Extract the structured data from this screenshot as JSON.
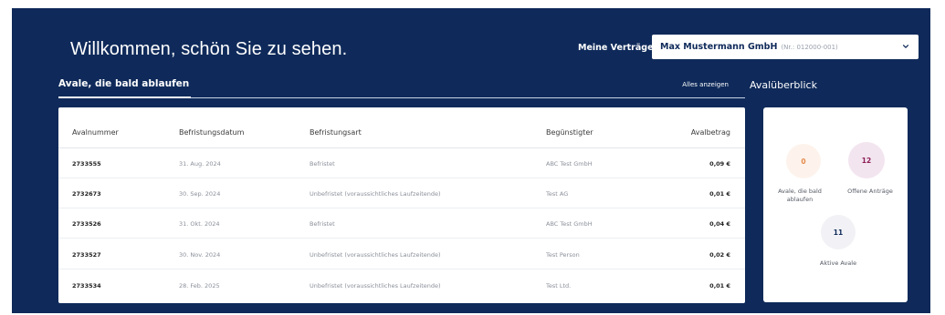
{
  "header": {
    "welcome": "Willkommen, schön Sie zu sehen.",
    "contracts_label": "Meine Verträge",
    "contract_name": "Max Mustermann GmbH",
    "contract_nr": "(Nr.: 012000-001)"
  },
  "tabs": {
    "active_label": "Avale, die bald ablaufen",
    "show_all": "Alles anzeigen"
  },
  "table": {
    "headers": [
      "Avalnummer",
      "Befristungsdatum",
      "Befristungsart",
      "Begünstigter",
      "Avalbetrag"
    ],
    "rows": [
      [
        "2733555",
        "31. Aug. 2024",
        "Befristet",
        "ABC Test GmbH",
        "0,09 €"
      ],
      [
        "2732673",
        "30. Sep. 2024",
        "Unbefristet (voraussichtliches Laufzeitende)",
        "Test AG",
        "0,01 €"
      ],
      [
        "2733526",
        "31. Okt. 2024",
        "Befristet",
        "ABC Test GmbH",
        "0,04 €"
      ],
      [
        "2733527",
        "30. Nov. 2024",
        "Unbefristet (voraussichtliches Laufzeitende)",
        "Test Person",
        "0,02 €"
      ],
      [
        "2733534",
        "28. Feb. 2025",
        "Unbefristet (voraussichtliches Laufzeitende)",
        "Test Ltd.",
        "0,01 €"
      ]
    ]
  },
  "overview": {
    "title": "Avalüberblick",
    "expiring_count": "0",
    "expiring_label": "Avale, die bald ablaufen",
    "open_count": "12",
    "open_label": "Offene Anträge",
    "active_count": "11",
    "active_label": "Aktive Avale"
  },
  "colors": {
    "background": "#0f2a5a",
    "accent_orange": "#e58a4a",
    "accent_magenta": "#8c1d57"
  }
}
